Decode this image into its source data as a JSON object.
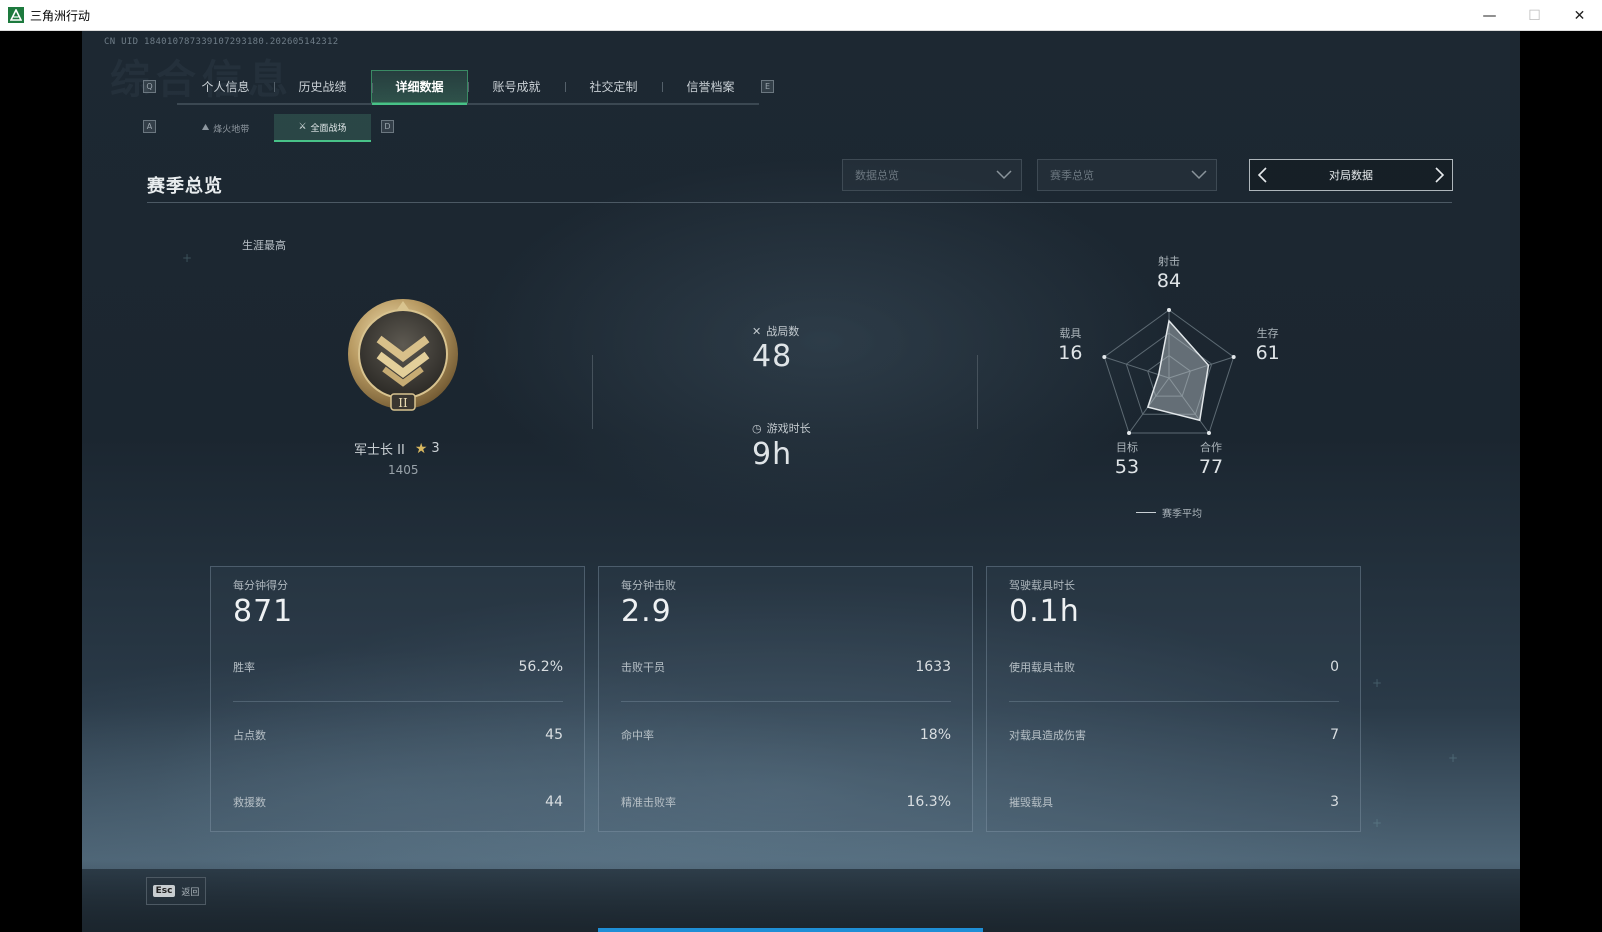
{
  "window": {
    "title": "三角洲行动",
    "buttons": {
      "minimize": "—",
      "maximize": "☐",
      "close": "✕"
    }
  },
  "uid_text": "CN UID 184010787339107293180.202605142312",
  "watermark": "综合信息",
  "hints": {
    "tab_prev": "Q",
    "tab_next": "E",
    "sub_prev": "A",
    "sub_next": "D"
  },
  "tabs": [
    {
      "label": "个人信息"
    },
    {
      "label": "历史战绩"
    },
    {
      "label": "详细数据",
      "active": true
    },
    {
      "label": "账号成就"
    },
    {
      "label": "社交定制"
    },
    {
      "label": "信誉档案"
    }
  ],
  "subtabs": [
    {
      "label": "烽火地带",
      "icon": "mountain-icon"
    },
    {
      "label": "全面战场",
      "icon": "crosshair-icon",
      "active": true
    }
  ],
  "section_title": "赛季总览",
  "filters": {
    "data_overview": "数据总览",
    "season_overview": "赛季总览",
    "pager_label": "对局数据"
  },
  "rank": {
    "career_label": "生涯最高",
    "name": "军士长 II",
    "stars": "3",
    "score": "1405",
    "badge_numeral": "II"
  },
  "stats": {
    "matches_label": "战局数",
    "matches_value": "48",
    "playtime_label": "游戏时长",
    "playtime_value": "9h"
  },
  "radar": {
    "axes": [
      {
        "label": "射击",
        "value": 84
      },
      {
        "label": "生存",
        "value": 61
      },
      {
        "label": "合作",
        "value": 77
      },
      {
        "label": "目标",
        "value": 53
      },
      {
        "label": "载具",
        "value": 16
      }
    ],
    "max": 100,
    "legend": "赛季平均"
  },
  "cards": [
    {
      "title": "每分钟得分",
      "value": "871",
      "rows": [
        {
          "label": "胜率",
          "value": "56.2%"
        },
        {
          "label": "占点数",
          "value": "45"
        },
        {
          "label": "救援数",
          "value": "44"
        }
      ]
    },
    {
      "title": "每分钟击败",
      "value": "2.9",
      "rows": [
        {
          "label": "击败干员",
          "value": "1633"
        },
        {
          "label": "命中率",
          "value": "18%"
        },
        {
          "label": "精准击败率",
          "value": "16.3%"
        }
      ]
    },
    {
      "title": "驾驶载具时长",
      "value": "0.1h",
      "rows": [
        {
          "label": "使用载具击败",
          "value": "0"
        },
        {
          "label": "对载具造成伤害",
          "value": "7"
        },
        {
          "label": "摧毁载具",
          "value": "3"
        }
      ]
    }
  ],
  "footer": {
    "esc_key": "Esc",
    "back_label": "返回"
  },
  "colors": {
    "accent": "#48c288",
    "progress": "#1f8fd6"
  }
}
